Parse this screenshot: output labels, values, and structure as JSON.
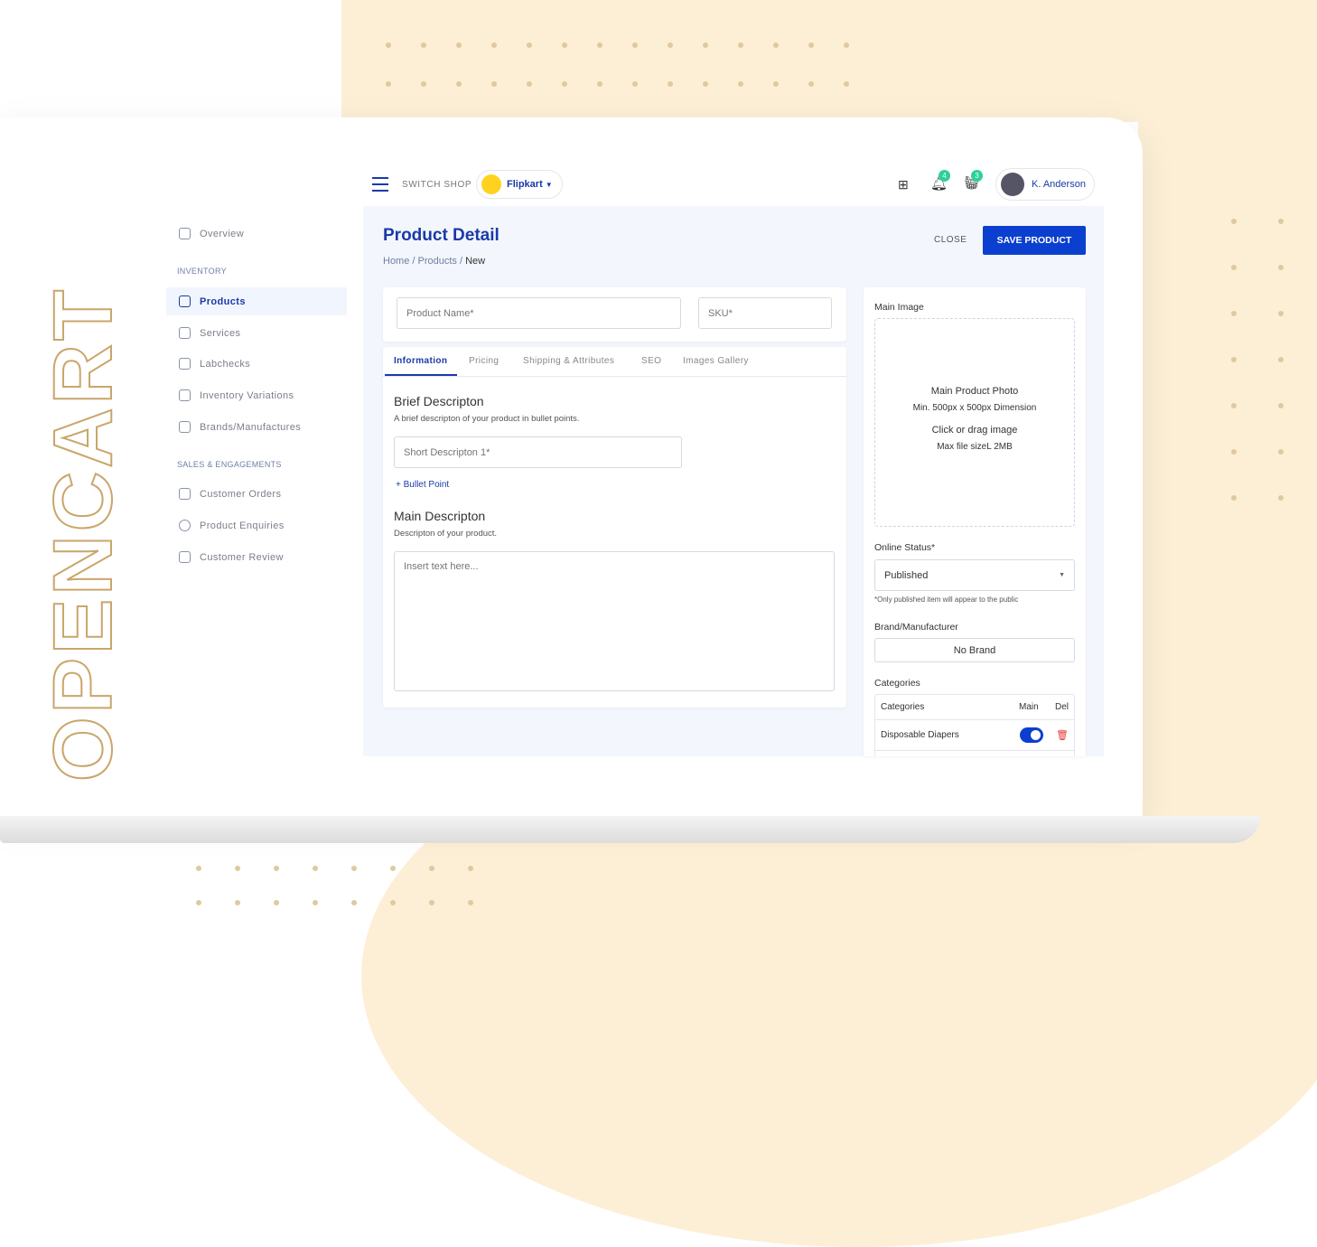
{
  "brand": {
    "logo_text": "OPENCART"
  },
  "header": {
    "menu_icon": "hamburger-icon",
    "switch_shop": "SWITCH SHOP",
    "shop_name": "Flipkart",
    "notifications_count": "4",
    "cart_count": "3",
    "user_name": "K. Anderson"
  },
  "sidebar": {
    "overview": "Overview",
    "inventory_head": "INVENTORY",
    "inventory": [
      {
        "label": "Products",
        "icon": "grid-icon",
        "active": true
      },
      {
        "label": "Services",
        "icon": "services-icon"
      },
      {
        "label": "Labchecks",
        "icon": "test-tube-icon"
      },
      {
        "label": "Inventory Variations",
        "icon": "sliders-icon"
      },
      {
        "label": "Brands/Manufactures",
        "icon": "fingerprint-icon"
      }
    ],
    "sales_head": "SALES & ENGAGEMENTS",
    "sales": [
      {
        "label": "Customer Orders",
        "icon": "document-icon"
      },
      {
        "label": "Product Enquiries",
        "icon": "headset-icon"
      },
      {
        "label": "Customer Review",
        "icon": "review-icon"
      }
    ]
  },
  "page": {
    "title": "Product Detail",
    "breadcrumb": [
      "Home",
      "Products",
      "New"
    ],
    "close": "CLOSE",
    "save": "SAVE PRODUCT"
  },
  "form": {
    "product_name_placeholder": "Product Name*",
    "sku_placeholder": "SKU*",
    "tabs": [
      "Information",
      "Pricing",
      "Shipping & Attributes",
      "SEO",
      "Images Gallery"
    ],
    "brief_title": "Brief Descripton",
    "brief_sub": "A brief descripton of your product in bullet points.",
    "short_desc_placeholder": "Short Descripton 1*",
    "bullet_point": "+ Bullet Point",
    "main_title": "Main Descripton",
    "main_sub": "Descripton of your product.",
    "main_placeholder": "Insert text here..."
  },
  "right": {
    "main_image": "Main Image",
    "photo_title": "Main Product Photo",
    "photo_dim": "Min. 500px x 500px Dimension",
    "photo_click": "Click or drag image",
    "photo_max": "Max file sizeL 2MB",
    "online_status_label": "Online Status*",
    "online_status": "Published",
    "status_note": "*Only published item will appear to the public",
    "brand_label": "Brand/Manufacturer",
    "brand_value": "No Brand",
    "categories_label": "Categories",
    "cat_headers": [
      "Categories",
      "Main",
      "Del"
    ],
    "cat_rows": [
      {
        "name": "Disposable Diapers",
        "main": true
      }
    ]
  },
  "colors": {
    "accent": "#0b3fcf",
    "peach": "#fdefd6",
    "toggle": "#0b3fcf",
    "delete": "#e53935",
    "badge": "#2ccf9f"
  }
}
